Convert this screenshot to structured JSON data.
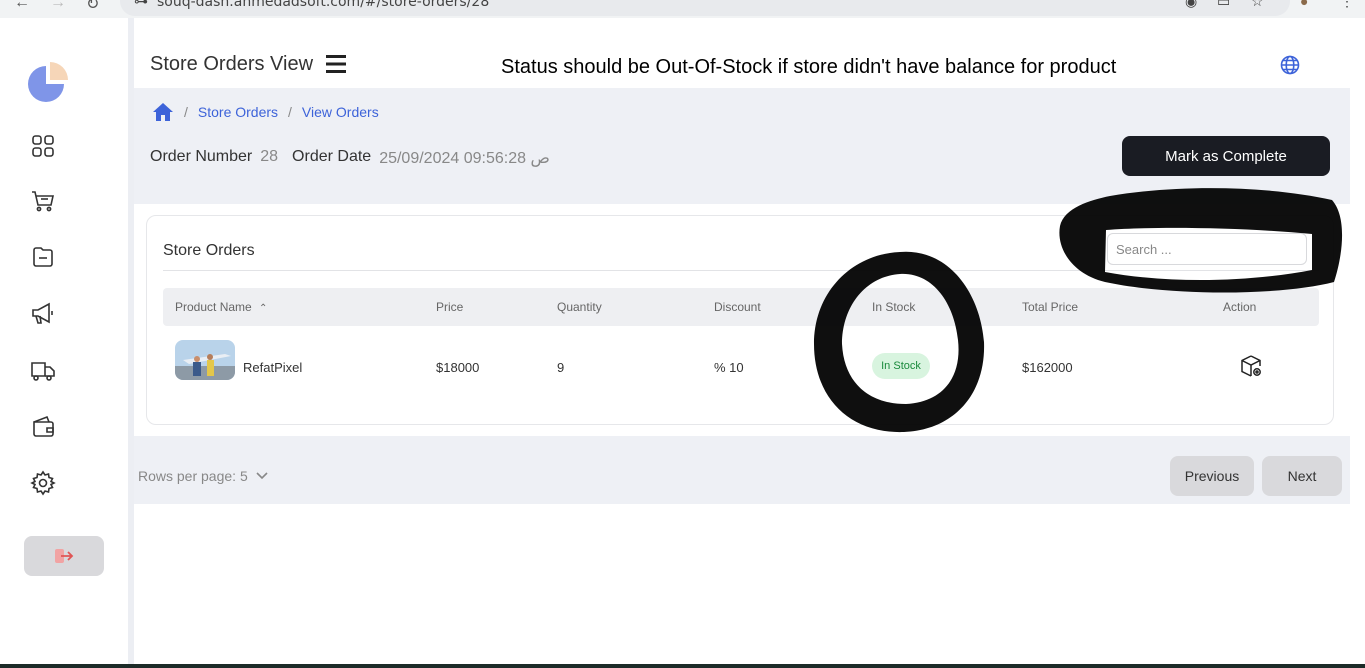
{
  "browser": {
    "url": "souq-dash.ahmedadsoft.com/#/store-orders/28"
  },
  "header": {
    "title": "Store Orders View",
    "annotation": "Status should be Out-Of-Stock if store didn't have balance for product"
  },
  "breadcrumb": {
    "items": [
      "Store Orders",
      "View Orders"
    ],
    "separator": "/"
  },
  "order": {
    "number_label": "Order Number",
    "number_value": "28",
    "date_label": "Order Date",
    "date_value": "25/09/2024 09:56:28 ص"
  },
  "actions": {
    "mark_complete": "Mark as Complete"
  },
  "table": {
    "title": "Store Orders",
    "search_placeholder": "Search ...",
    "columns": [
      "Product Name",
      "Price",
      "Quantity",
      "Discount",
      "In Stock",
      "Total Price",
      "Action"
    ],
    "rows": [
      {
        "product_name": "RefatPixel",
        "price": "$18000",
        "quantity": "9",
        "discount": "% 10",
        "stock_status": "In Stock",
        "total_price": "$162000"
      }
    ]
  },
  "pagination": {
    "rows_per_page": "Rows per page: 5",
    "previous": "Previous",
    "next": "Next"
  },
  "colors": {
    "accent": "#3d63d9",
    "dark_button": "#1a1c23",
    "in_stock_bg": "#d8f4df",
    "in_stock_text": "#1a8a3c"
  },
  "icons": {
    "sidebar": [
      "dashboard-icon",
      "cart-icon",
      "folder-icon",
      "megaphone-icon",
      "delivery-truck-icon",
      "wallet-icon",
      "gear-icon",
      "logout-icon"
    ],
    "header": [
      "hamburger-icon",
      "globe-icon",
      "home-icon"
    ],
    "row_action": "box-settings-icon"
  }
}
